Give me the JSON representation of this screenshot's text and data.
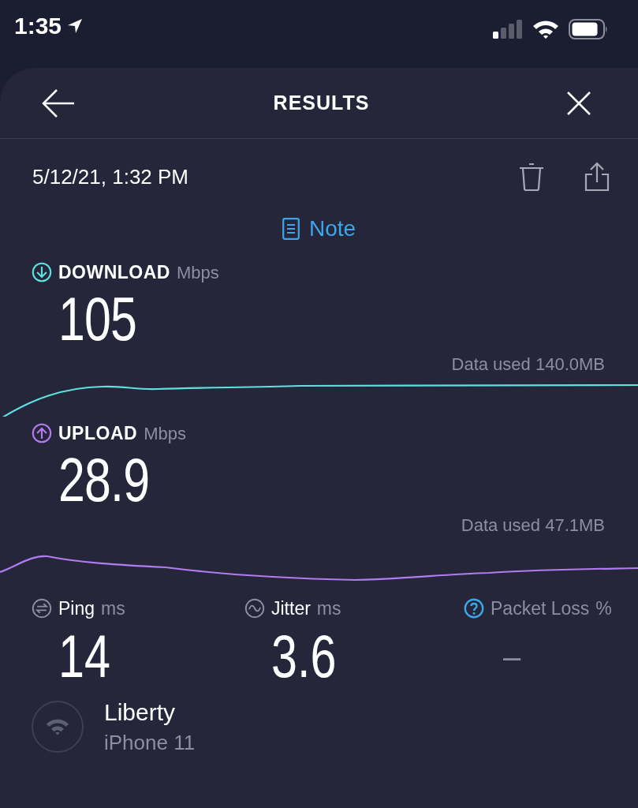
{
  "status_bar": {
    "time": "1:35"
  },
  "header": {
    "title": "RESULTS"
  },
  "result": {
    "date": "5/12/21, 1:32 PM",
    "note": "Note"
  },
  "speeds": [
    {
      "kind": "download",
      "label": "DOWNLOAD",
      "unit": "Mbps",
      "value": "105",
      "data_used": "Data used 140.0MB"
    },
    {
      "kind": "upload",
      "label": "UPLOAD",
      "unit": "Mbps",
      "value": "28.9",
      "data_used": "Data used 47.1MB"
    }
  ],
  "metrics": [
    {
      "kind": "ping",
      "label": "Ping",
      "unit": "ms",
      "value": "14",
      "disabled": false
    },
    {
      "kind": "jitter",
      "label": "Jitter",
      "unit": "ms",
      "value": "3.6",
      "disabled": false
    },
    {
      "kind": "packet_loss",
      "label": "Packet Loss",
      "unit": "%",
      "value": "–",
      "disabled": true
    }
  ],
  "network": {
    "name": "Liberty",
    "device": "iPhone 11"
  }
}
